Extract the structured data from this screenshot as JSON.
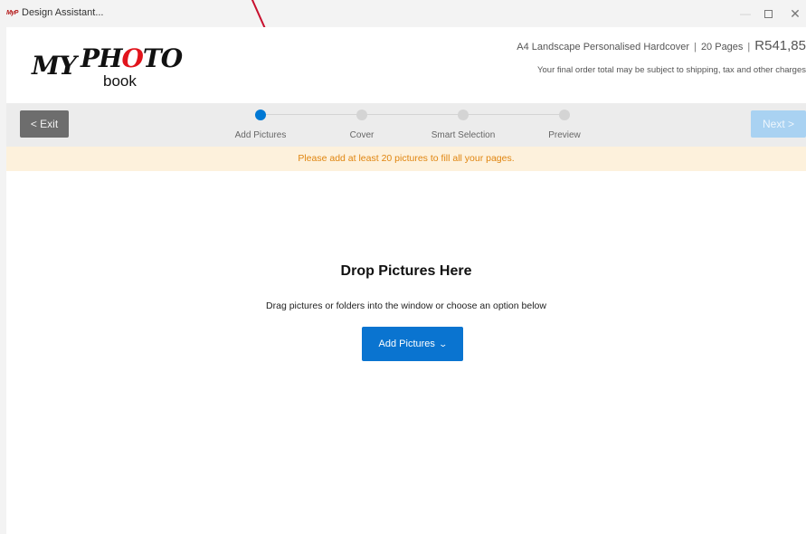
{
  "titlebar": {
    "app_icon": "app-logo-icon",
    "title": "Design Assistant...",
    "controls": {
      "minimize": "minimize-icon",
      "maximize": "maximize-icon",
      "close": "close-icon"
    }
  },
  "header": {
    "logo": {
      "my": "MY",
      "photo_p": "PH",
      "photo_o": "O",
      "photo_rest": "TO",
      "book": "book"
    },
    "product": "A4 Landscape Personalised Hardcover",
    "separator": "|",
    "pages": "20 Pages",
    "price": "R541,85",
    "note": "Your final order total may be subject to shipping, tax and other charges"
  },
  "stepbar": {
    "exit_label": "< Exit",
    "next_label": "Next >",
    "steps": [
      {
        "label": "Add Pictures",
        "active": true
      },
      {
        "label": "Cover",
        "active": false
      },
      {
        "label": "Smart Selection",
        "active": false
      },
      {
        "label": "Preview",
        "active": false
      }
    ]
  },
  "warning": "Please add at least 20 pictures to fill all your pages.",
  "dropzone": {
    "title": "Drop Pictures Here",
    "subtitle": "Drag pictures or folders into the window or choose an option below",
    "add_button": "Add Pictures",
    "add_button_icon": "chevron-down-icon"
  },
  "colors": {
    "accent": "#0078d4",
    "warning_bg": "#fdf1dc",
    "warning_text": "#e0850f",
    "logo_red": "#e1141c"
  }
}
